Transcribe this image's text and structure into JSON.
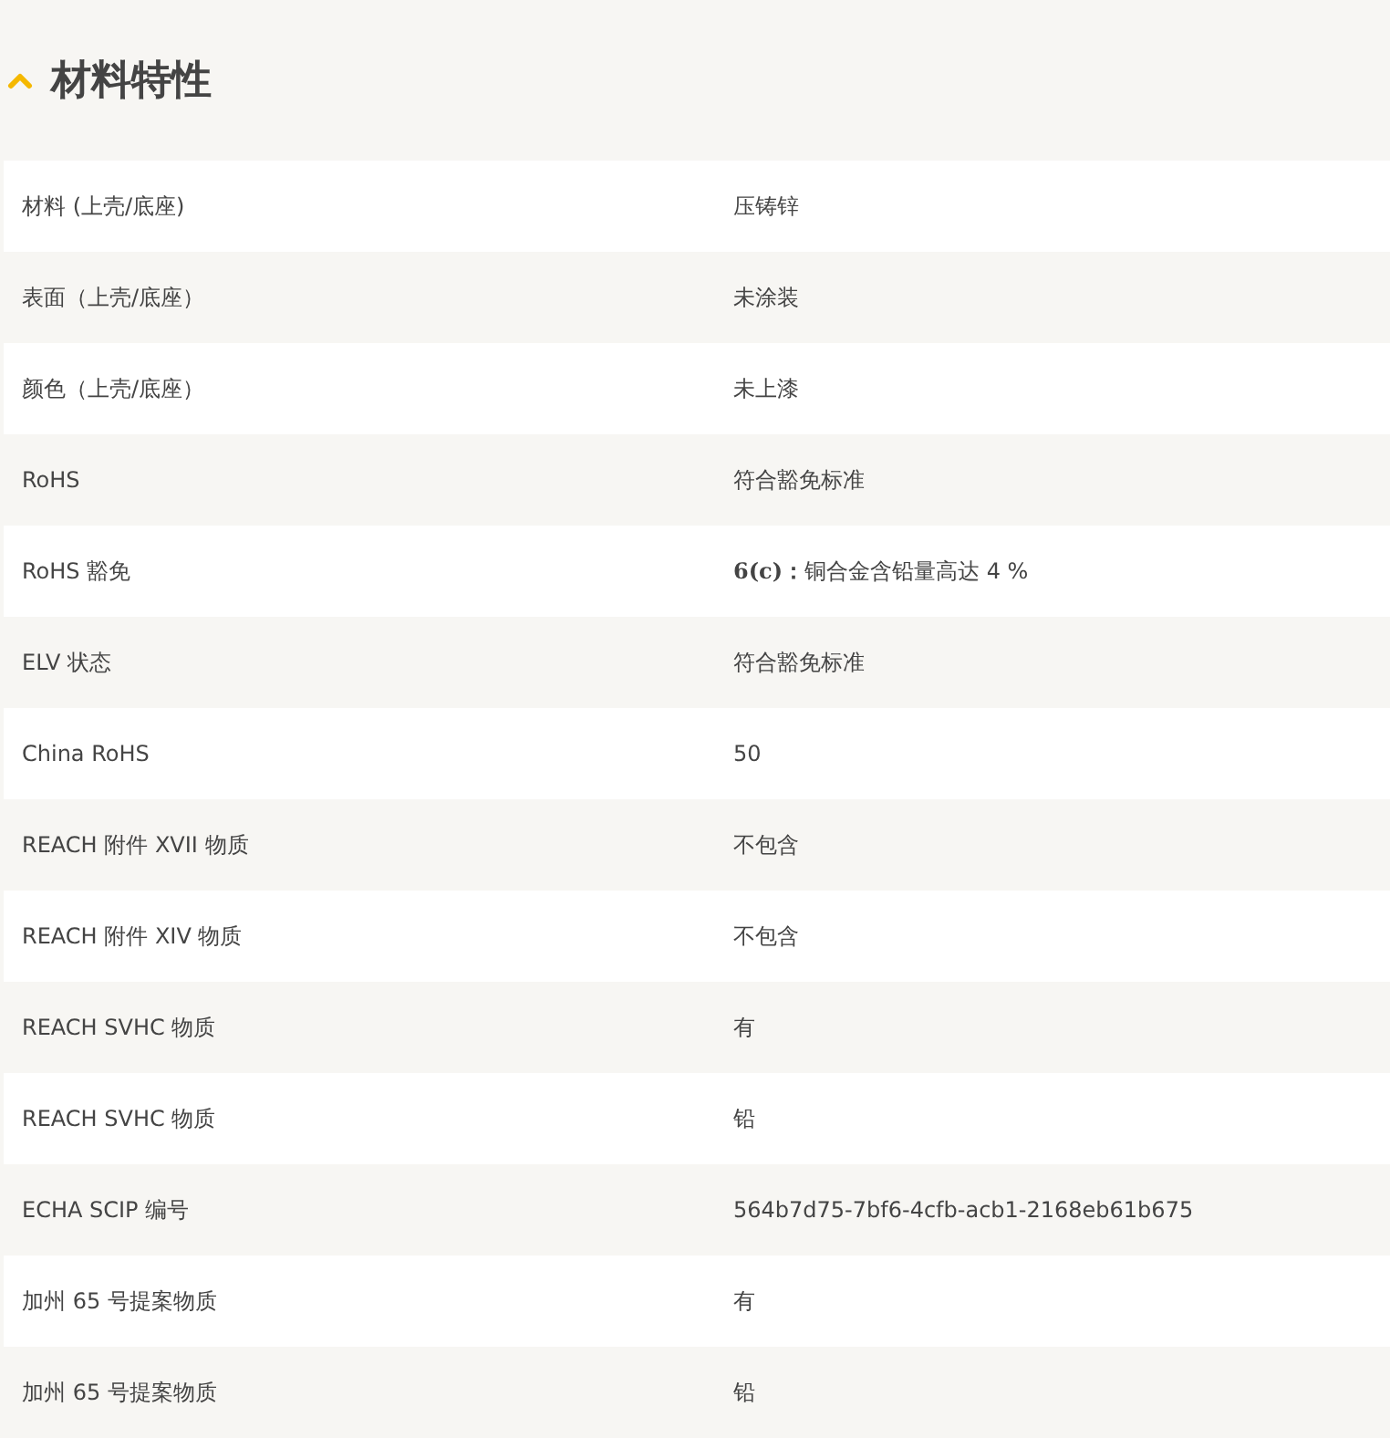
{
  "section": {
    "title": "材料特性",
    "expanded": true
  },
  "rows": [
    {
      "label": "材料 (上壳/底座)",
      "value": "压铸锌"
    },
    {
      "label": "表面（上壳/底座）",
      "value": "未涂装"
    },
    {
      "label": "颜色（上壳/底座）",
      "value": "未上漆"
    },
    {
      "label": "RoHS",
      "value": "符合豁免标准"
    },
    {
      "label": "RoHS 豁免",
      "value": "**6(c)：**铜合金含铅量高达 4 %"
    },
    {
      "label": "ELV 状态",
      "value": "符合豁免标准"
    },
    {
      "label": "China RoHS",
      "value": "50"
    },
    {
      "label": "REACH 附件 XVII 物质",
      "value": "不包含"
    },
    {
      "label": "REACH 附件 XIV 物质",
      "value": "不包含"
    },
    {
      "label": "REACH SVHC 物质",
      "value": "有"
    },
    {
      "label": "REACH SVHC 物质",
      "value": "铅"
    },
    {
      "label": "ECHA SCIP 编号",
      "value": "564b7d75-7bf6-4cfb-acb1-2168eb61b675"
    },
    {
      "label": "加州 65 号提案物质",
      "value": "有"
    },
    {
      "label": "加州 65 号提案物质",
      "value": "铅"
    }
  ]
}
